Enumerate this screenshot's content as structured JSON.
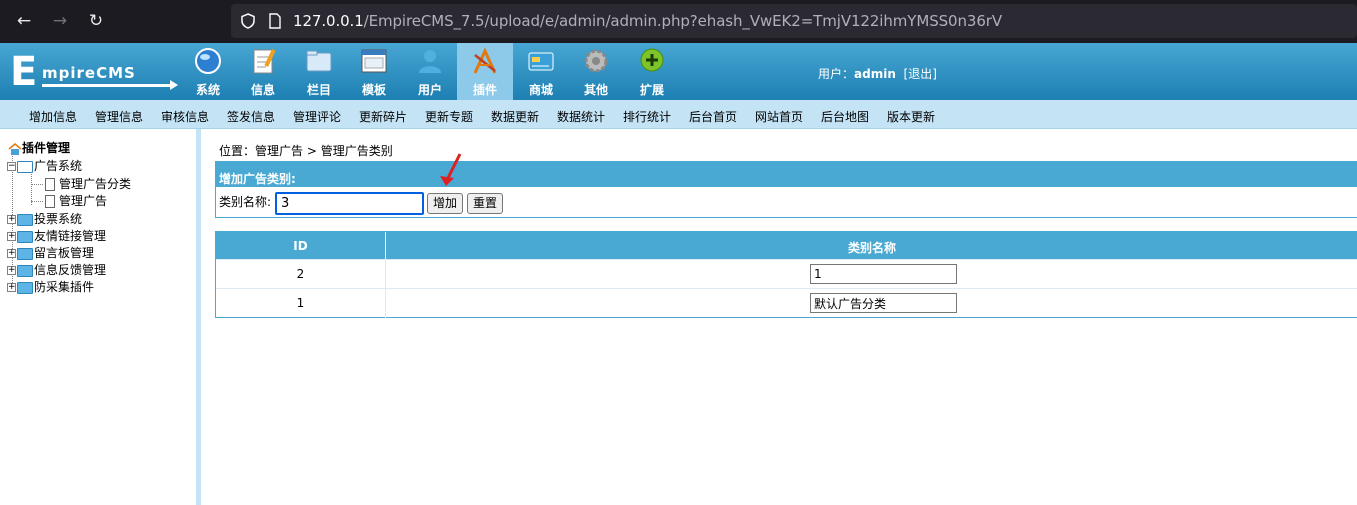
{
  "browser": {
    "url_host": "127.0.0.1",
    "url_path": "/EmpireCMS_7.5/upload/e/admin/admin.php?ehash_VwEK2=TmjV122ihmYMSS0n36rV"
  },
  "header": {
    "logo_e": "E",
    "logo_text": "mpireCMS",
    "nav": [
      {
        "label": "系统",
        "icon": "globe-icon"
      },
      {
        "label": "信息",
        "icon": "notepad-icon"
      },
      {
        "label": "栏目",
        "icon": "folder-icon"
      },
      {
        "label": "模板",
        "icon": "window-icon"
      },
      {
        "label": "用户",
        "icon": "user-icon"
      },
      {
        "label": "插件",
        "icon": "tools-icon",
        "active": true
      },
      {
        "label": "商城",
        "icon": "card-icon"
      },
      {
        "label": "其他",
        "icon": "gear-icon"
      },
      {
        "label": "扩展",
        "icon": "plus-icon"
      }
    ],
    "user_label": "用户：",
    "username": "admin",
    "logout": "[退出]"
  },
  "subnav": [
    "增加信息",
    "管理信息",
    "审核信息",
    "签发信息",
    "管理评论",
    "更新碎片",
    "更新专题",
    "数据更新",
    "数据统计",
    "排行统计",
    "后台首页",
    "网站首页",
    "后台地图",
    "版本更新"
  ],
  "sidebar": {
    "root": "插件管理",
    "items": [
      {
        "label": "广告系统",
        "expanded": true,
        "children": [
          "管理广告分类",
          "管理广告"
        ]
      },
      {
        "label": "投票系统"
      },
      {
        "label": "友情链接管理"
      },
      {
        "label": "留言板管理"
      },
      {
        "label": "信息反馈管理"
      },
      {
        "label": "防采集插件"
      }
    ]
  },
  "main": {
    "breadcrumb_prefix": "位置：",
    "breadcrumb_link1": "管理广告",
    "breadcrumb_sep": " > ",
    "breadcrumb_link2": "管理广告类别",
    "add_title": "增加广告类别:",
    "add_label": "类别名称:",
    "add_value": "3",
    "add_button": "增加",
    "reset_button": "重置",
    "table": {
      "headers": [
        "ID",
        "类别名称"
      ],
      "rows": [
        {
          "id": "2",
          "name": "1"
        },
        {
          "id": "1",
          "name": "默认广告分类"
        }
      ]
    }
  },
  "colors": {
    "header_blue": "#2f8ebd",
    "subnav_bg": "#c4e3f5",
    "table_head": "#4aa9d3",
    "annotation_arrow": "#e02020"
  }
}
